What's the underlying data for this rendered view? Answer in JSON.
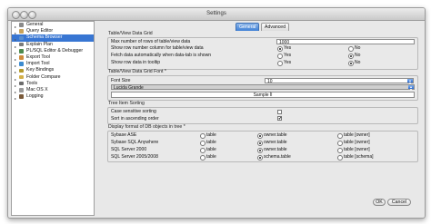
{
  "window": {
    "title": "Settings"
  },
  "tabs": [
    {
      "label": "General",
      "active": true
    },
    {
      "label": "Advanced",
      "active": false
    }
  ],
  "sidebar": {
    "items": [
      {
        "label": "General",
        "icon": "gear-icon",
        "color": "#8a8a8a"
      },
      {
        "label": "Query Editor",
        "icon": "document-icon",
        "color": "#c9a35a"
      },
      {
        "label": "Schema Browser",
        "icon": "tree-icon",
        "color": "#5a8fcf",
        "selected": true
      },
      {
        "label": "Explain Plan",
        "icon": "plan-icon",
        "color": "#7b7b7b"
      },
      {
        "label": "PL/SQL Editor & Debugger",
        "icon": "code-icon",
        "color": "#4d8a4d"
      },
      {
        "label": "Export Tool",
        "icon": "export-icon",
        "color": "#d08b3c"
      },
      {
        "label": "Import Tool",
        "icon": "import-icon",
        "color": "#3c8bd0"
      },
      {
        "label": "Key Bindings",
        "icon": "key-icon",
        "color": "#b39a2d"
      },
      {
        "label": "Folder Compare",
        "icon": "folder-icon",
        "color": "#d4b04a"
      },
      {
        "label": "Tools",
        "icon": "wrench-icon",
        "color": "#6d6d6d"
      },
      {
        "label": "Mac OS X",
        "icon": "apple-icon",
        "color": "#9a9a9a"
      },
      {
        "label": "Logging",
        "icon": "log-icon",
        "color": "#7a5a3a"
      }
    ]
  },
  "table_view": {
    "title": "Table/View Data Grid",
    "max_rows_label": "Max number of rows of table/view data",
    "max_rows_value": "1000",
    "rows": [
      {
        "label": "Show row number column for table/view data",
        "yes": "Yes",
        "no": "No",
        "selected": "yes"
      },
      {
        "label": "Fetch data automatically when data-tab is shown",
        "yes": "Yes",
        "no": "No",
        "selected": "no"
      },
      {
        "label": "Show row data in tooltip",
        "yes": "Yes",
        "no": "No",
        "selected": "no"
      }
    ]
  },
  "font": {
    "title": "Table/View Data Grid Font *",
    "size_label": "Font Size",
    "size_value": "10",
    "family_value": "Lucida Grande",
    "sample_label": "Sample İl"
  },
  "sorting": {
    "title": "Tree Item Sorting",
    "case_label": "Case sensitive sorting",
    "case_checked": false,
    "asc_label": "Sort in ascending order",
    "asc_checked": true
  },
  "display": {
    "title": "Display format of DB objects in tree *",
    "rows": [
      {
        "label": "Sybase ASE",
        "opts": [
          "table",
          "owner.table",
          "table [owner]"
        ],
        "selected": 1
      },
      {
        "label": "Sybase SQL Anywhere",
        "opts": [
          "table",
          "owner.table",
          "table [owner]"
        ],
        "selected": 1
      },
      {
        "label": "SQL Server 2000",
        "opts": [
          "table",
          "owner.table",
          "table [owner]"
        ],
        "selected": 1
      },
      {
        "label": "SQL Server 2005/2008",
        "opts": [
          "table",
          "schema.table",
          "table [schema]"
        ],
        "selected": 1
      }
    ]
  },
  "buttons": {
    "ok": "OK",
    "cancel": "Cancel"
  }
}
